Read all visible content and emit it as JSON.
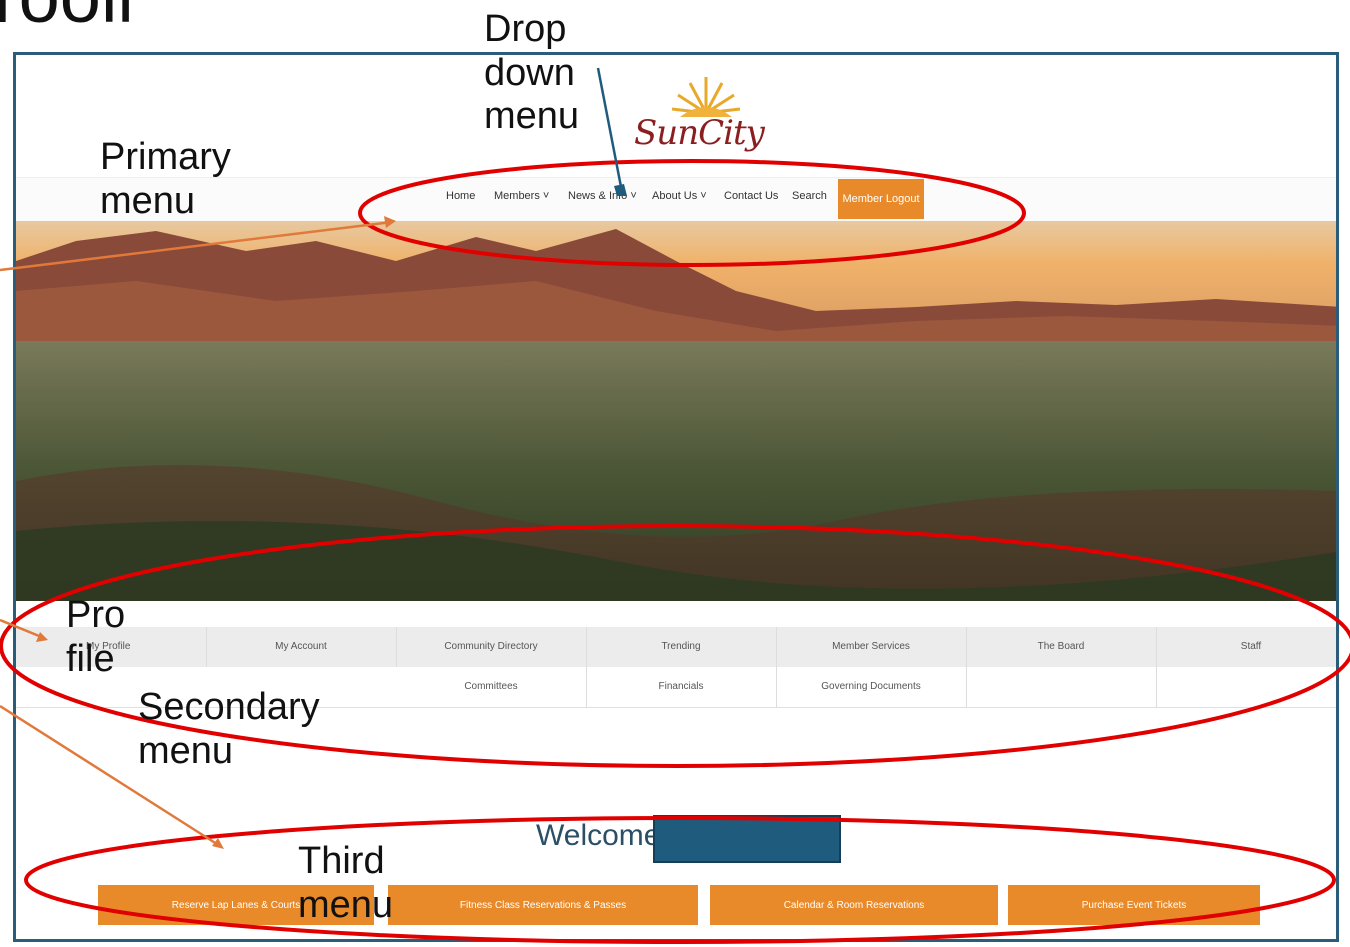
{
  "slide": {
    "title_fragment": "rooll"
  },
  "logo": {
    "text": "SunCity"
  },
  "primary_nav": {
    "items": [
      "Home",
      "Members ˅",
      "News & Info ˅",
      "About Us ˅",
      "Contact Us",
      "Search"
    ],
    "logout_label": "Member Logout"
  },
  "secondary_nav": {
    "row1": [
      "My Profile",
      "My Account",
      "Community Directory",
      "Trending",
      "Member Services",
      "The Board",
      "Staff"
    ],
    "row2": [
      "Committees",
      "Financials",
      "Governing Documents"
    ]
  },
  "welcome": {
    "text": "Welcome"
  },
  "third_nav": {
    "buttons": [
      "Reserve Lap Lanes & Courts",
      "Fitness Class Reservations & Passes",
      "Calendar & Room Reservations",
      "Purchase Event Tickets"
    ]
  },
  "annotations": {
    "drop_down_menu": [
      "Drop",
      "down",
      "menu"
    ],
    "primary_menu": [
      "Primary",
      "menu"
    ],
    "profile": [
      "Pro",
      "file"
    ],
    "secondary_menu": [
      "Secondary",
      "menu"
    ],
    "third_menu": [
      "Third",
      "menu"
    ]
  },
  "colors": {
    "accent": "#e88a2a",
    "frame": "#2a5d7a",
    "annotation_ellipse": "#e10000",
    "annotation_arrow_orange": "#e0793a",
    "annotation_arrow_blue": "#1f5b7c"
  }
}
